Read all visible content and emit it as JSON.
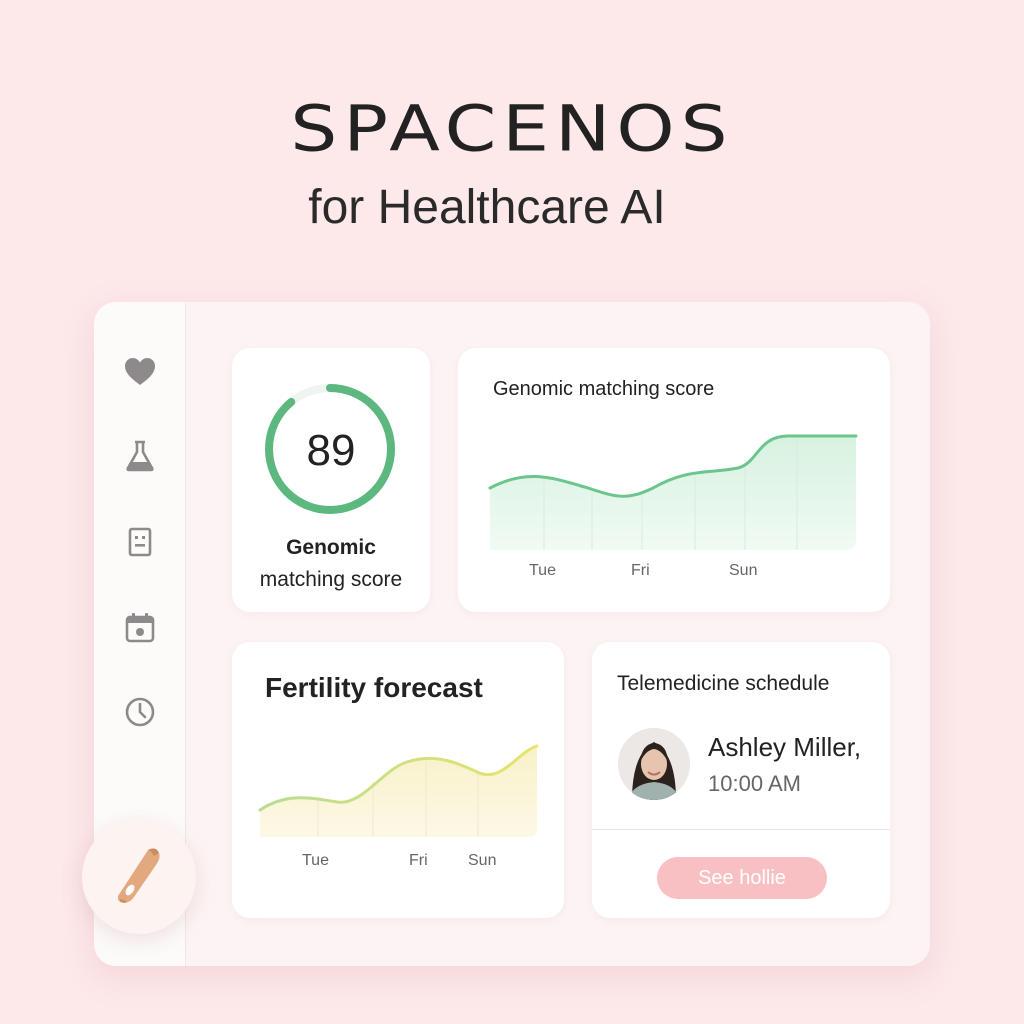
{
  "brand": {
    "title": "SPACENOS",
    "tagline": "for Healthcare AI"
  },
  "sidebar": {
    "items": [
      {
        "icon": "heart-icon"
      },
      {
        "icon": "flask-icon"
      },
      {
        "icon": "document-icon"
      },
      {
        "icon": "calendar-icon"
      },
      {
        "icon": "clock-icon"
      }
    ],
    "fab_icon": "pen-icon"
  },
  "score_card": {
    "value": "89",
    "progress": 0.89,
    "label_line1": "Genomic",
    "label_line2": "matching score",
    "accent": "#5cb87e"
  },
  "genomic_chart": {
    "title": "Genomic matching score",
    "chart_data": {
      "type": "area",
      "x": [
        "Tue",
        "Fri",
        "Sun"
      ],
      "title": "Genomic matching score",
      "color": "#6cc58c"
    }
  },
  "fertility_chart": {
    "title": "Fertility forecast",
    "chart_data": {
      "type": "area",
      "x": [
        "Tue",
        "Fri",
        "Sun"
      ],
      "title": "Fertility forecast",
      "color": "#b9dd86"
    }
  },
  "telemedicine": {
    "title": "Telemedicine schedule",
    "patient_name": "Ashley Miller,",
    "time": "10:00 AM",
    "button_label": "See hollie"
  }
}
